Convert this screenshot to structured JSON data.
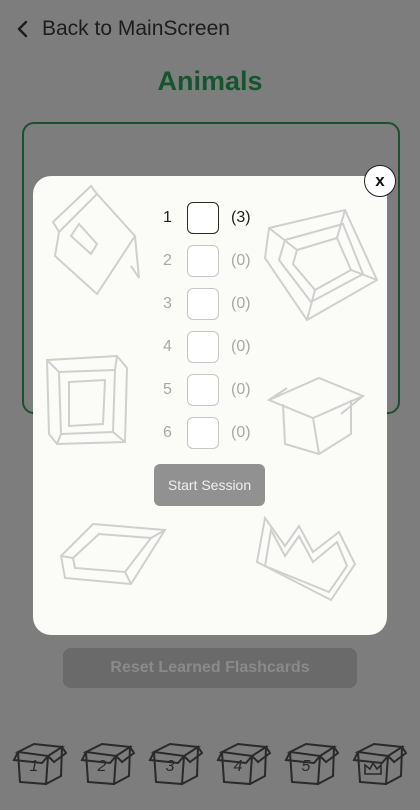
{
  "header": {
    "back_label": "Back to MainScreen",
    "title": "Animals"
  },
  "modal": {
    "close_label": "x",
    "boxes": [
      {
        "index": "1",
        "count": "(3)",
        "checked": false,
        "enabled": true
      },
      {
        "index": "2",
        "count": "(0)",
        "checked": false,
        "enabled": false
      },
      {
        "index": "3",
        "count": "(0)",
        "checked": false,
        "enabled": false
      },
      {
        "index": "4",
        "count": "(0)",
        "checked": false,
        "enabled": false
      },
      {
        "index": "5",
        "count": "(0)",
        "checked": false,
        "enabled": false
      },
      {
        "index": "6",
        "count": "(0)",
        "checked": false,
        "enabled": false
      }
    ],
    "start_label": "Start Session"
  },
  "reset_label": "Reset Learned Flashcards",
  "bottom_boxes": [
    "1",
    "2",
    "3",
    "4",
    "5",
    ""
  ],
  "colors": {
    "title": "#14552e",
    "overlay": "#7d7d7d",
    "modal_bg": "#fbfcf8"
  }
}
